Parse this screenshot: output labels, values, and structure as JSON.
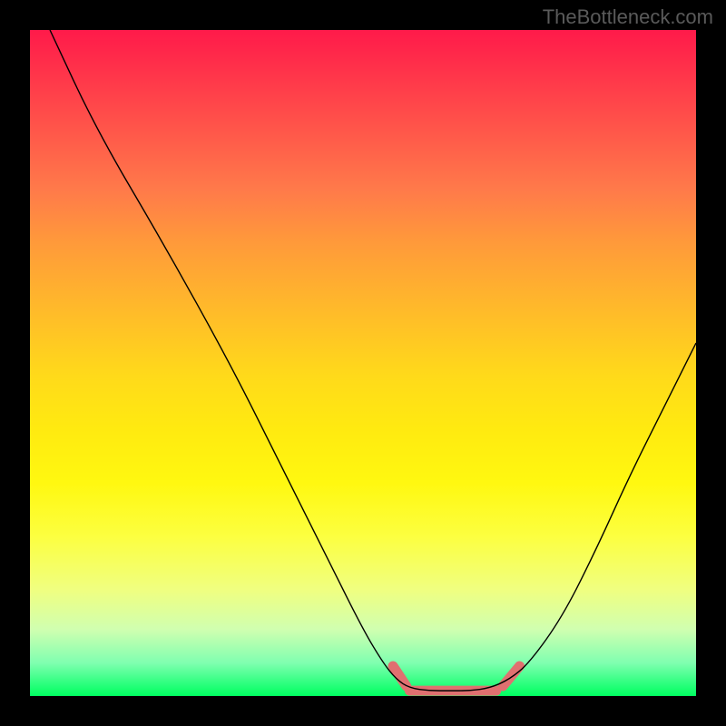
{
  "watermark": "TheBottleneck.com",
  "chart_data": {
    "type": "line",
    "title": "",
    "xlabel": "",
    "ylabel": "",
    "xlim": [
      0,
      100
    ],
    "ylim": [
      0,
      100
    ],
    "series": [
      {
        "name": "curve",
        "color": "#000000",
        "points": [
          {
            "x": 3,
            "y": 100
          },
          {
            "x": 10,
            "y": 85
          },
          {
            "x": 20,
            "y": 68
          },
          {
            "x": 30,
            "y": 50
          },
          {
            "x": 38,
            "y": 34
          },
          {
            "x": 45,
            "y": 20
          },
          {
            "x": 50,
            "y": 10
          },
          {
            "x": 53,
            "y": 5
          },
          {
            "x": 55,
            "y": 2.5
          },
          {
            "x": 57,
            "y": 1.2
          },
          {
            "x": 60,
            "y": 0.8
          },
          {
            "x": 63,
            "y": 0.8
          },
          {
            "x": 66,
            "y": 0.8
          },
          {
            "x": 69,
            "y": 1.2
          },
          {
            "x": 72,
            "y": 2.5
          },
          {
            "x": 75,
            "y": 5
          },
          {
            "x": 80,
            "y": 12
          },
          {
            "x": 85,
            "y": 22
          },
          {
            "x": 90,
            "y": 33
          },
          {
            "x": 95,
            "y": 43
          },
          {
            "x": 100,
            "y": 53
          }
        ]
      }
    ],
    "highlights": [
      {
        "name": "left-tick",
        "x1": 54.5,
        "y1": 4.5,
        "x2": 56.5,
        "y2": 1.5,
        "angle": -60
      },
      {
        "name": "flat-region",
        "x1": 57,
        "y1": 0.8,
        "x2": 70,
        "y2": 0.8,
        "angle": 0
      },
      {
        "name": "right-tick",
        "x1": 71,
        "y1": 1.5,
        "x2": 73.5,
        "y2": 4.5,
        "angle": 50
      }
    ],
    "highlight_color": "#e07070"
  }
}
